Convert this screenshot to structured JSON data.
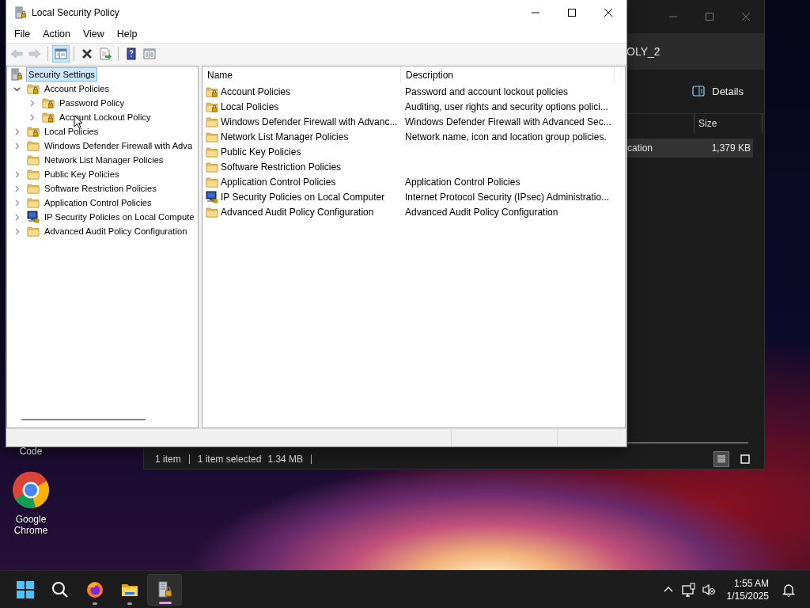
{
  "desktop_icons": [
    {
      "kind": "code",
      "label": "Code"
    },
    {
      "kind": "chrome",
      "label": "Google Chrome"
    }
  ],
  "explorer_window": {
    "address": "OLY_2",
    "toolbar_button": "Details",
    "column": "Size",
    "row": {
      "name": "cation",
      "size": "1,379 KB",
      "selected": true
    },
    "status": [
      "1 item",
      "1 item selected",
      "1.34 MB"
    ],
    "views": [
      {
        "kind": "details",
        "selected": true
      },
      {
        "kind": "tiles",
        "selected": false
      }
    ]
  },
  "window": {
    "title": "Local Security Policy",
    "menu": [
      "File",
      "Action",
      "View",
      "Help"
    ],
    "toolbar": [
      {
        "kind": "back",
        "disabled": true,
        "pressed": false
      },
      {
        "kind": "forward",
        "disabled": true,
        "pressed": false
      },
      {
        "kind": "sep"
      },
      {
        "kind": "tree",
        "disabled": false,
        "pressed": true
      },
      {
        "kind": "sep"
      },
      {
        "kind": "delete",
        "disabled": false,
        "pressed": false
      },
      {
        "kind": "export",
        "disabled": false,
        "pressed": false
      },
      {
        "kind": "sep"
      },
      {
        "kind": "help",
        "disabled": false,
        "pressed": false
      },
      {
        "kind": "properties",
        "disabled": false,
        "pressed": false
      }
    ],
    "tree": [
      {
        "label": "Security Settings",
        "kind": "secpol",
        "selected": true,
        "children": [
          {
            "label": "Account Policies",
            "kind": "lock_folder",
            "expandable": true,
            "expanded": true,
            "selected": false,
            "children": [
              {
                "label": "Password Policy",
                "kind": "lock_folder",
                "expandable": true,
                "expanded": false,
                "selected": false
              },
              {
                "label": "Account Lockout Policy",
                "kind": "lock_folder",
                "expandable": true,
                "expanded": false,
                "selected": false
              }
            ]
          },
          {
            "label": "Local Policies",
            "kind": "lock_folder",
            "expandable": true,
            "expanded": false,
            "selected": false
          },
          {
            "label": "Windows Defender Firewall with Adva",
            "kind": "folder",
            "expandable": true,
            "expanded": false,
            "selected": false
          },
          {
            "label": "Network List Manager Policies",
            "kind": "folder",
            "selected": false
          },
          {
            "label": "Public Key Policies",
            "kind": "folder",
            "expandable": true,
            "expanded": false,
            "selected": false
          },
          {
            "label": "Software Restriction Policies",
            "kind": "folder",
            "expandable": true,
            "expanded": false,
            "selected": false
          },
          {
            "label": "Application Control Policies",
            "kind": "folder",
            "expandable": true,
            "expanded": false,
            "selected": false
          },
          {
            "label": "IP Security Policies on Local Compute",
            "kind": "ip_security",
            "expandable": true,
            "expanded": false,
            "selected": false
          },
          {
            "label": "Advanced Audit Policy Configuration",
            "kind": "folder",
            "expandable": true,
            "expanded": false,
            "selected": false
          }
        ]
      }
    ],
    "list": {
      "columns": [
        "Name",
        "Description"
      ],
      "rows": [
        {
          "kind": "lock_folder",
          "name": "Account Policies",
          "description": "Password and account lockout policies"
        },
        {
          "kind": "lock_folder",
          "name": "Local Policies",
          "description": "Auditing, user rights and security options polici..."
        },
        {
          "kind": "folder",
          "name": "Windows Defender Firewall with Advanc...",
          "description": "Windows Defender Firewall with Advanced Sec..."
        },
        {
          "kind": "folder",
          "name": "Network List Manager Policies",
          "description": "Network name, icon and location group policies."
        },
        {
          "kind": "folder",
          "name": "Public Key Policies"
        },
        {
          "kind": "folder",
          "name": "Software Restriction Policies"
        },
        {
          "kind": "folder",
          "name": "Application Control Policies",
          "description": "Application Control Policies"
        },
        {
          "kind": "ip_security",
          "name": "IP Security Policies on Local Computer",
          "description": "Internet Protocol Security (IPsec) Administratio..."
        },
        {
          "kind": "folder",
          "name": "Advanced Audit Policy Configuration",
          "description": "Advanced Audit Policy Configuration"
        }
      ]
    }
  },
  "taskbar": {
    "apps": [
      {
        "kind": "start",
        "running": false,
        "active": false
      },
      {
        "kind": "search",
        "running": false,
        "active": false
      },
      {
        "kind": "firefox",
        "running": true,
        "active": false
      },
      {
        "kind": "files",
        "running": true,
        "active": false
      },
      {
        "kind": "secpol",
        "running": true,
        "active": true
      }
    ],
    "time": "1:55 AM",
    "date": "1/15/2025"
  }
}
